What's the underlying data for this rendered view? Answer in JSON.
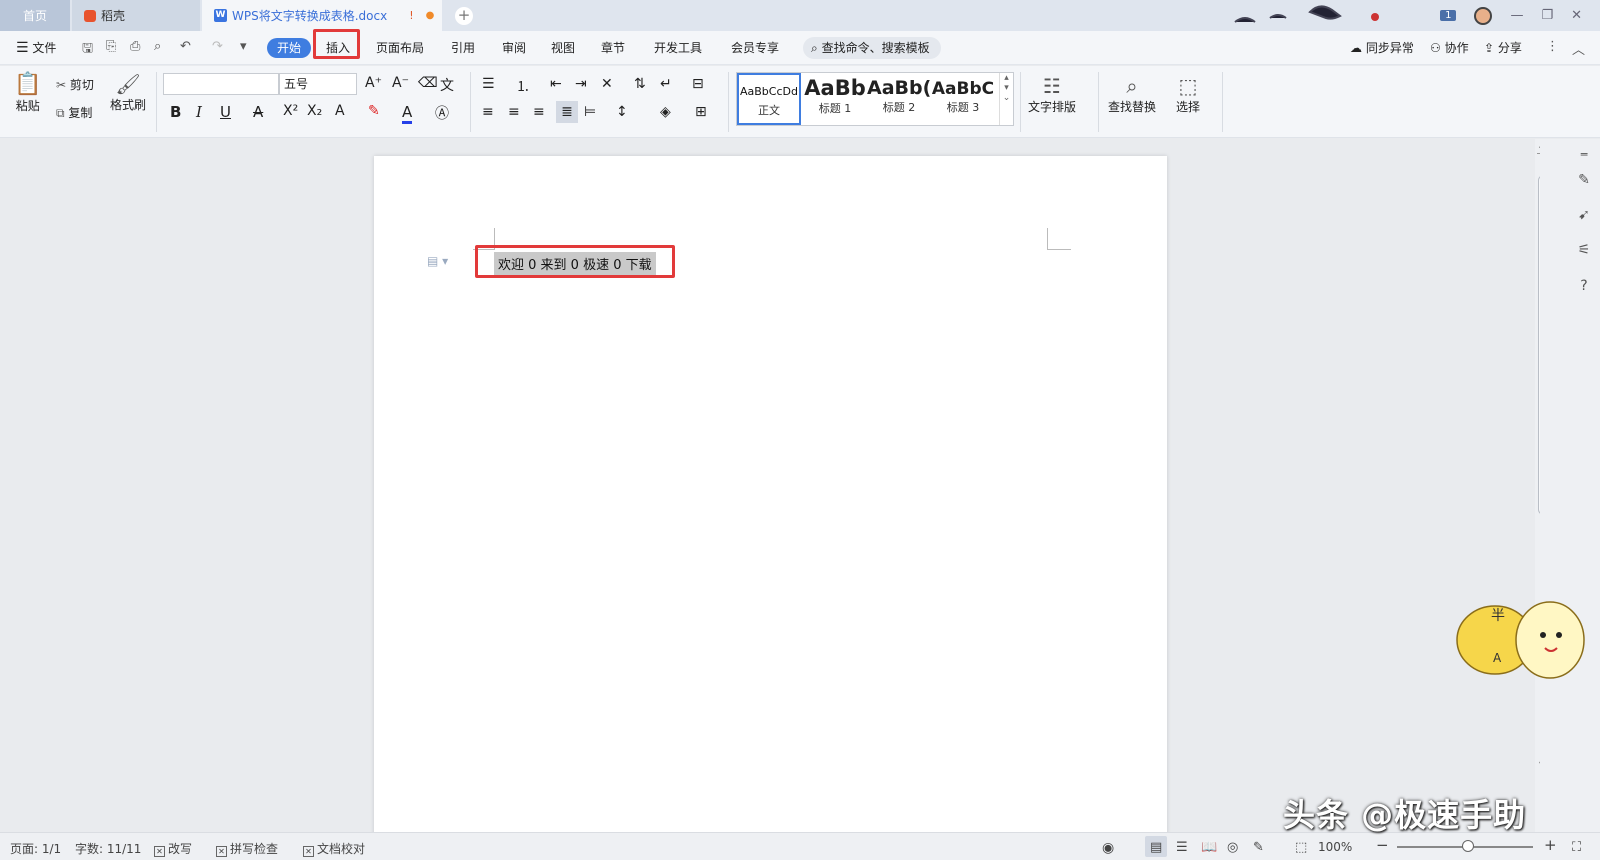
{
  "tabs": {
    "home": "首页",
    "daoke": "稻壳",
    "doc": "WPS将文字转换成表格.docx",
    "doc_warn": "!",
    "doc_dot": "●",
    "add": "+"
  },
  "window": {
    "badge": "1",
    "min": "—",
    "restore": "❐",
    "close": "✕"
  },
  "menubar": {
    "file": "文件",
    "tabs": [
      "开始",
      "插入",
      "页面布局",
      "引用",
      "审阅",
      "视图",
      "章节",
      "开发工具",
      "会员专享"
    ],
    "search": "查找命令、搜索模板",
    "sync": "同步异常",
    "collab": "协作",
    "share": "分享"
  },
  "ribbon": {
    "paste": "粘贴",
    "cut": "剪切",
    "copy": "复制",
    "format_painter": "格式刷",
    "font_name": "",
    "font_size": "五号",
    "styles": [
      {
        "preview": "AaBbCcDd",
        "caption": "正文"
      },
      {
        "preview": "AaBb",
        "caption": "标题 1"
      },
      {
        "preview": "AaBb(",
        "caption": "标题 2"
      },
      {
        "preview": "AaBbC",
        "caption": "标题 3"
      }
    ],
    "text_layout": "文字排版",
    "find_replace": "查找替换",
    "select": "选择"
  },
  "document": {
    "line": "欢迎 0 来到 0 极速 0 下载"
  },
  "statusbar": {
    "page": "页面: 1/1",
    "words": "字数: 11/11",
    "revise": "改写",
    "spell": "拼写检查",
    "proof": "文档校对",
    "zoom": "100%",
    "minus": "−",
    "plus": "+"
  },
  "watermark": "头条 @极速手助",
  "colors": {
    "accent": "#3f7de0",
    "highlight_box": "#e23a3a",
    "selection": "#c9c9c9"
  }
}
